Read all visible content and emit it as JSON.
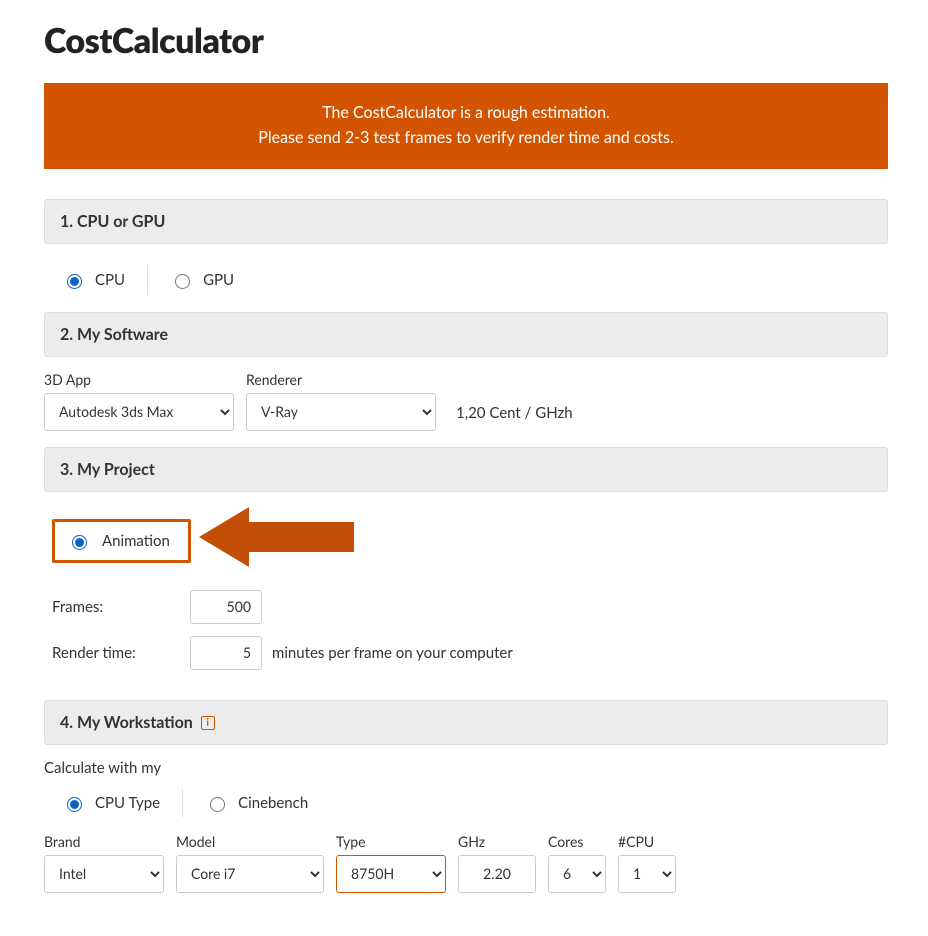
{
  "title": "CostCalculator",
  "banner": {
    "line1": "The CostCalculator is a rough estimation.",
    "line2": "Please send 2-3 test frames to verify render time and costs."
  },
  "section1": {
    "heading": "1. CPU or GPU",
    "cpuLabel": "CPU",
    "gpuLabel": "GPU"
  },
  "section2": {
    "heading": "2. My Software",
    "appLabel": "3D App",
    "appValue": "Autodesk 3ds Max",
    "rendererLabel": "Renderer",
    "rendererValue": "V-Ray",
    "price": "1,20 Cent / GHzh"
  },
  "section3": {
    "heading": "3. My Project",
    "animationLabel": "Animation",
    "framesLabel": "Frames:",
    "framesValue": "500",
    "renderLabel": "Render time:",
    "renderValue": "5",
    "renderSuffix": "minutes per frame on your computer"
  },
  "section4": {
    "heading": "4. My Workstation",
    "calcLabel": "Calculate with my",
    "cpuTypeLabel": "CPU Type",
    "cinebenchLabel": "Cinebench",
    "brandLabel": "Brand",
    "brandValue": "Intel",
    "modelLabel": "Model",
    "modelValue": "Core i7",
    "typeLabel": "Type",
    "typeValue": "8750H",
    "ghzLabel": "GHz",
    "ghzValue": "2.20",
    "coresLabel": "Cores",
    "coresValue": "6",
    "cpuCountLabel": "#CPU",
    "cpuCountValue": "1"
  }
}
